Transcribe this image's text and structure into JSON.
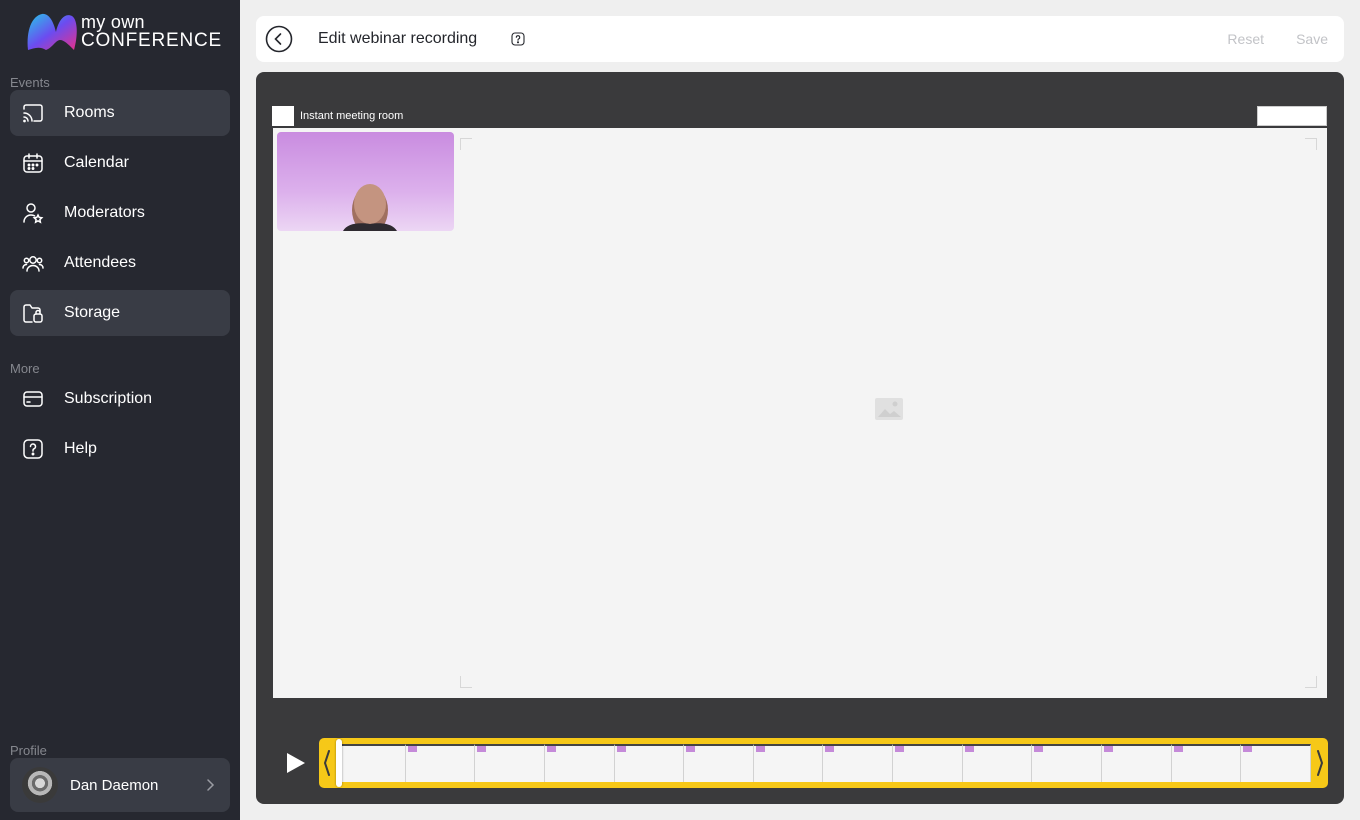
{
  "brand": {
    "line1": "my own",
    "line2": "CONFERENCE"
  },
  "sidebar": {
    "events_label": "Events",
    "more_label": "More",
    "profile_label": "Profile",
    "events_items": [
      {
        "label": "Rooms",
        "icon": "cast-icon",
        "active": true
      },
      {
        "label": "Calendar",
        "icon": "calendar-icon",
        "active": false
      },
      {
        "label": "Moderators",
        "icon": "moderator-icon",
        "active": false
      },
      {
        "label": "Attendees",
        "icon": "attendees-icon",
        "active": false
      },
      {
        "label": "Storage",
        "icon": "storage-icon",
        "active": true
      }
    ],
    "more_items": [
      {
        "label": "Subscription",
        "icon": "card-icon"
      },
      {
        "label": "Help",
        "icon": "help-icon"
      }
    ],
    "profile": {
      "name": "Dan Daemon"
    }
  },
  "header": {
    "title": "Edit webinar recording",
    "reset_label": "Reset",
    "save_label": "Save"
  },
  "recording": {
    "room_name": "Instant meeting room",
    "timeline_frames": 14,
    "accent_color": "#f6c818"
  },
  "colors": {
    "sidebar_bg": "#262830",
    "active_item_bg": "#393c45",
    "editor_bg": "#3a3a3c"
  }
}
